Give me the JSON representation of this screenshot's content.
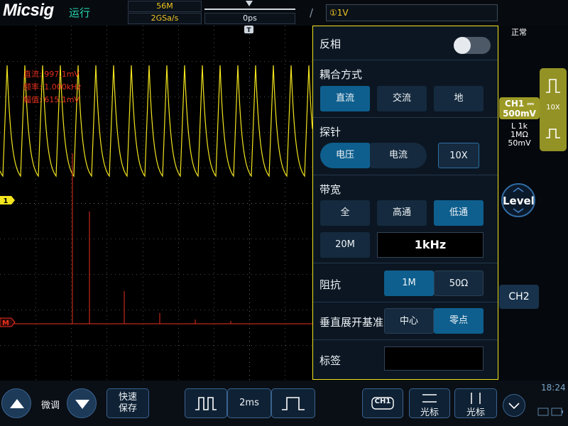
{
  "app": {
    "logo": "Micsig",
    "run_status": "运行",
    "status_mode": "正常",
    "clock": "18:24"
  },
  "acquisition": {
    "memory_depth": "56M",
    "sample_rate": "2GSa/s",
    "horizontal_offset": "0ps"
  },
  "trigger": {
    "slope_icon": "rising-edge-icon",
    "source_level": "①1V",
    "marker": "T"
  },
  "measurements": [
    "直流: 997.1mV",
    "频率: 1.000kHz",
    "幅值: 615.1mV"
  ],
  "markers": {
    "ch1": "1",
    "math": "M"
  },
  "colors": {
    "ch1": "#f3e51f",
    "math": "#e8301e",
    "accent_active": "#0e5f8e",
    "panel_bg": "#0b1622"
  },
  "panel": {
    "invert": {
      "label": "反相",
      "on": false
    },
    "coupling": {
      "label": "耦合方式",
      "options": [
        "直流",
        "交流",
        "地"
      ],
      "selected": "直流"
    },
    "probe": {
      "label": "探针",
      "options": [
        "电压",
        "电流"
      ],
      "selected": "电压",
      "ratio": "10X"
    },
    "bandwidth": {
      "label": "带宽",
      "options": [
        "全",
        "高通",
        "低通"
      ],
      "selected": "低通",
      "limit": "20M",
      "cutoff": "1kHz"
    },
    "impedance": {
      "label": "阻抗",
      "options": [
        "1M",
        "50Ω"
      ],
      "selected": "1M"
    },
    "vertical_ref": {
      "label": "垂直展开基准",
      "options": [
        "中心",
        "零点"
      ],
      "selected": "零点"
    },
    "tag": {
      "label": "标签",
      "value": ""
    }
  },
  "channel": {
    "name": "CH1",
    "coupling_icon": "dc-coupling-icon",
    "scale": "500mV",
    "filter": "L 1k",
    "impedance": "1MΩ",
    "offset": "50mV",
    "probe_ratio": "10X"
  },
  "level_knob": {
    "label": "Level"
  },
  "ch2_button": {
    "label": "CH2"
  },
  "bottom": {
    "fine_label": "微调",
    "quick_save": [
      "快速",
      "保存"
    ],
    "timebase": "2ms",
    "ch1_badge": "CH1",
    "cursor_h": "光标",
    "cursor_v": "光标"
  }
}
